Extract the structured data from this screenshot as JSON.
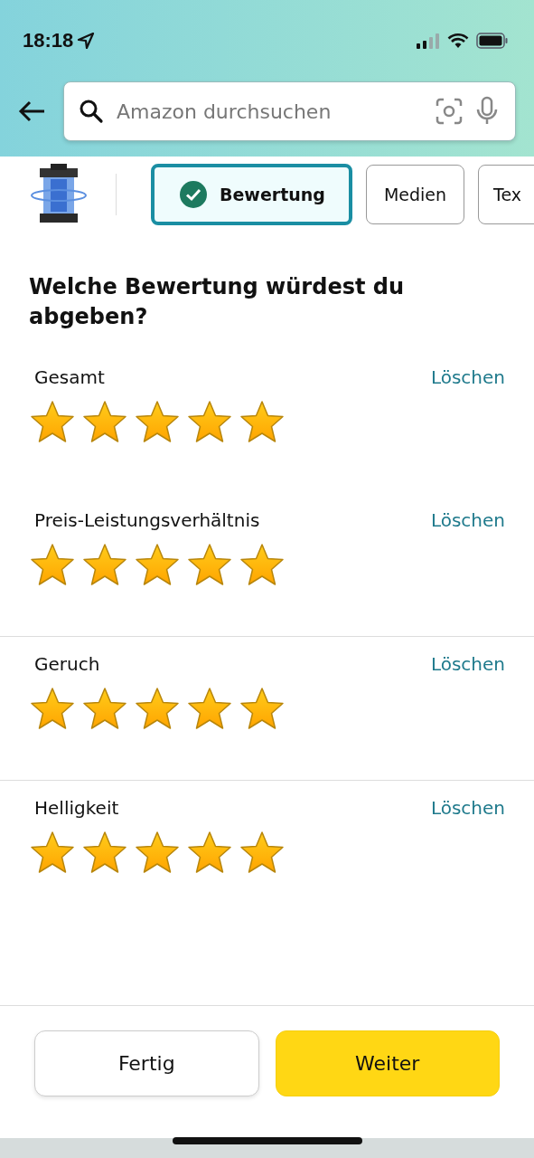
{
  "status_bar": {
    "time": "18:18"
  },
  "search": {
    "placeholder": "Amazon durchsuchen"
  },
  "steps": [
    {
      "label": "Bewertung",
      "selected": true,
      "done": true
    },
    {
      "label": "Medien",
      "selected": false,
      "done": false
    },
    {
      "label": "Tex",
      "selected": false,
      "done": false
    }
  ],
  "question": "Welche Bewertung würdest du abgeben?",
  "ratings": [
    {
      "label": "Gesamt",
      "action": "Löschen",
      "stars": 5,
      "divider": false
    },
    {
      "label": "Preis-Leistungsverhältnis",
      "action": "Löschen",
      "stars": 5,
      "divider": false
    },
    {
      "label": "Geruch",
      "action": "Löschen",
      "stars": 5,
      "divider": true
    },
    {
      "label": "Helligkeit",
      "action": "Löschen",
      "stars": 5,
      "divider": true
    }
  ],
  "buttons": [
    {
      "label": "Fertig",
      "kind": "secondary"
    },
    {
      "label": "Weiter",
      "kind": "primary"
    }
  ]
}
